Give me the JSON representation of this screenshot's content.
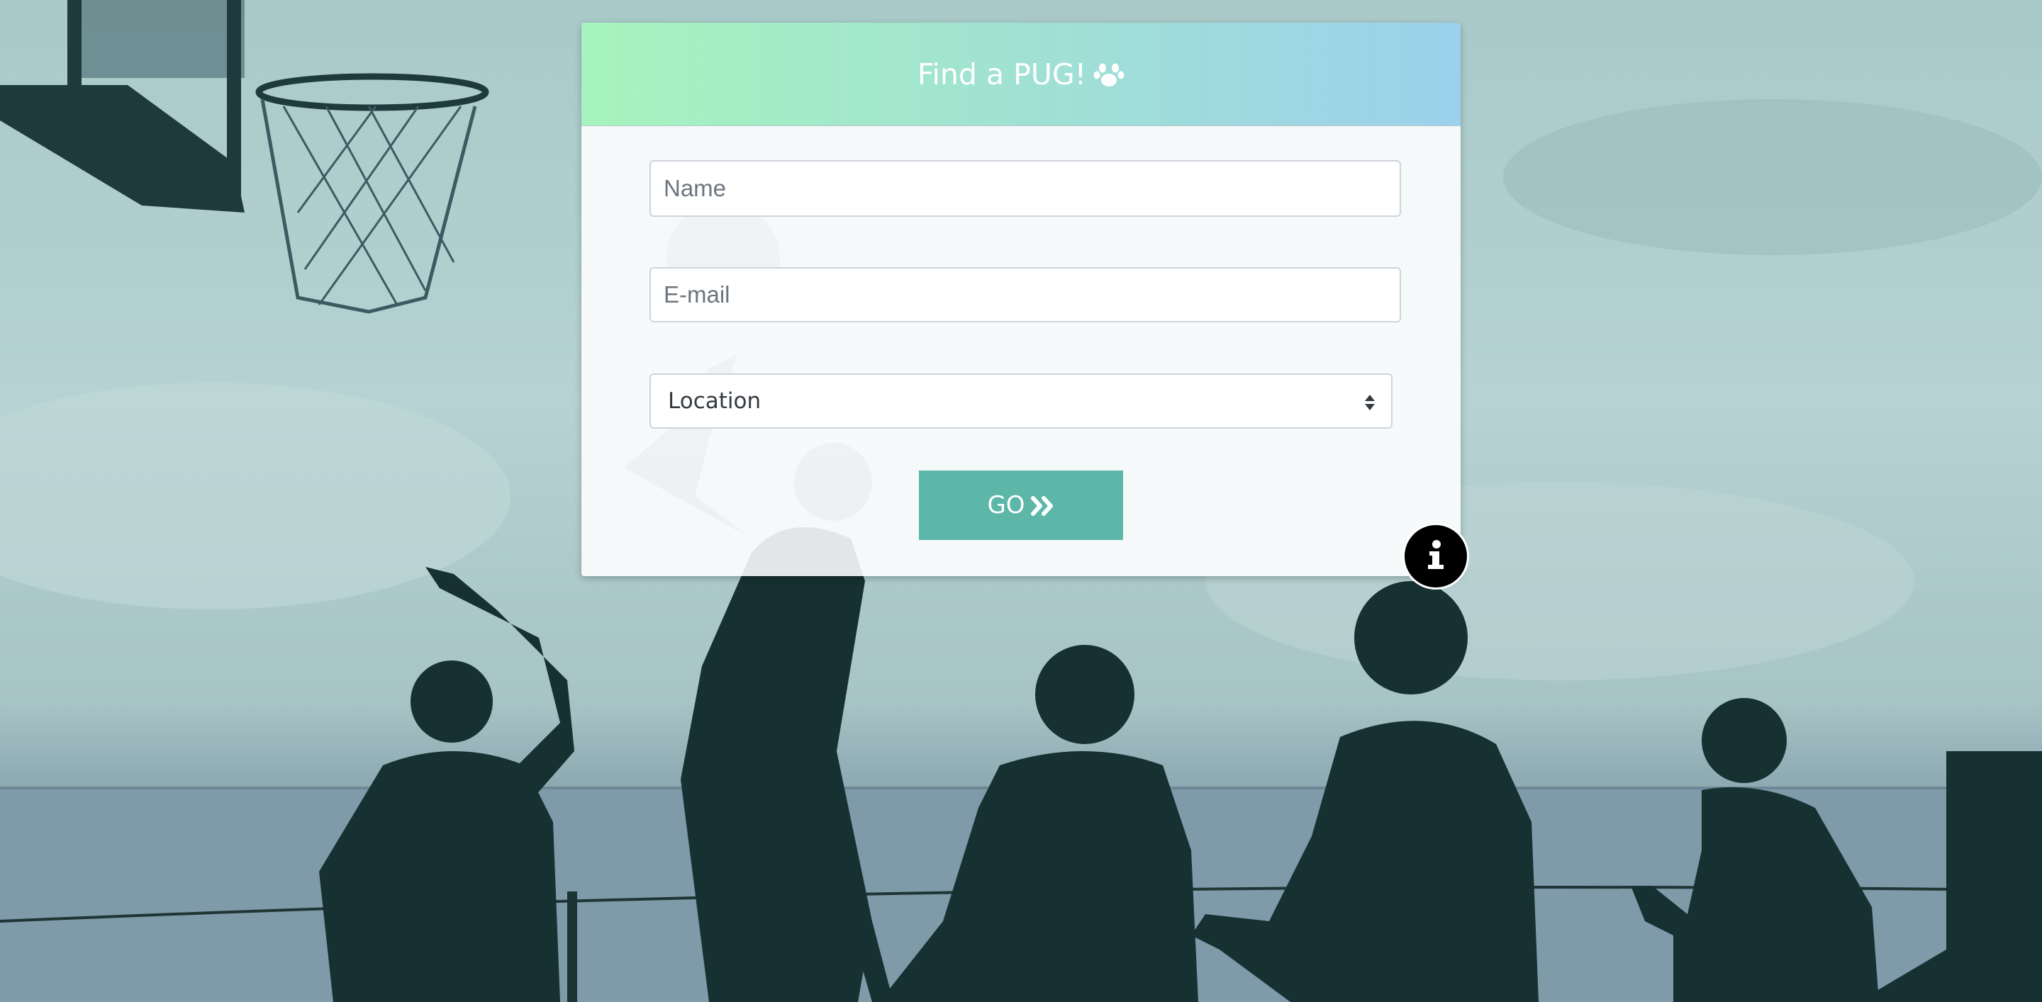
{
  "card": {
    "title": "Find a PUG!",
    "title_icon": "paw-icon"
  },
  "form": {
    "name_placeholder": "Name",
    "email_placeholder": "E-mail",
    "location_value": "Location",
    "go_label": "GO",
    "go_icon": "double-chevron-right-icon"
  },
  "info_button": {
    "icon": "info-icon"
  },
  "colors": {
    "header_gradient_start": "#a6f4bd",
    "header_gradient_end": "#9bd1ec",
    "go_button": "#5cb7a8",
    "info_button": "#000000"
  }
}
